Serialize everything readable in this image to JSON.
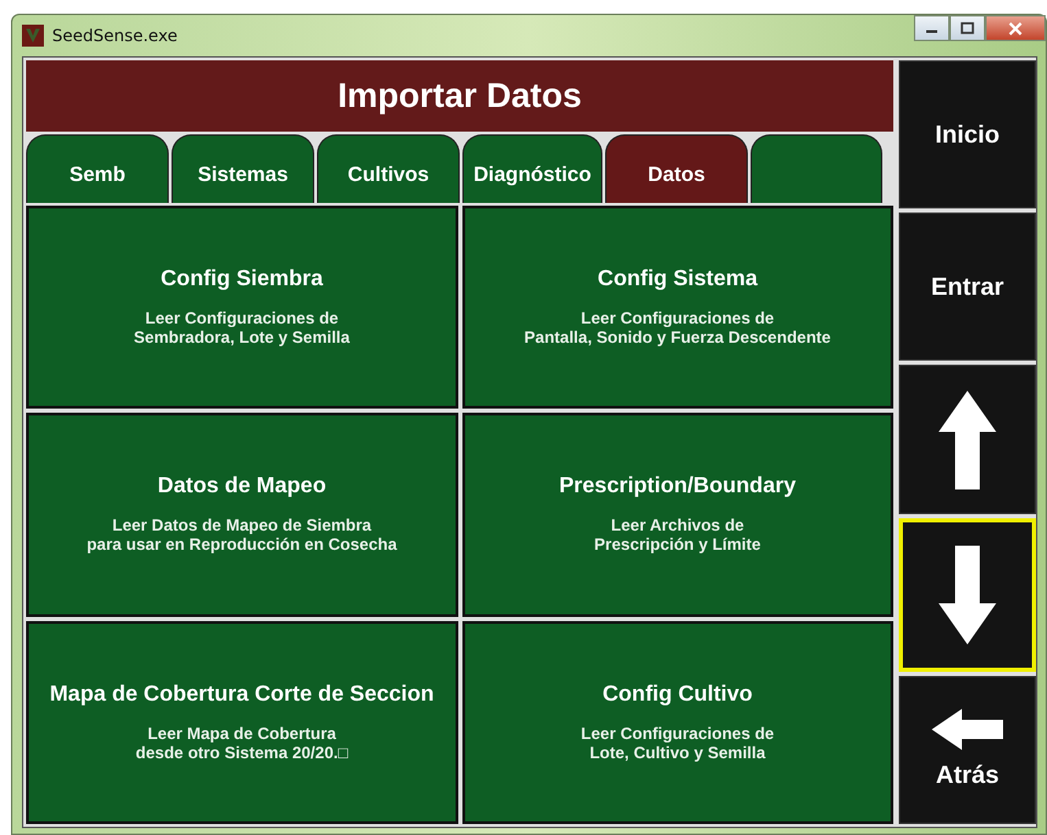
{
  "window": {
    "title": "SeedSense.exe"
  },
  "header": {
    "title": "Importar Datos"
  },
  "tabs": [
    {
      "label": "Semb",
      "selected": false
    },
    {
      "label": "Sistemas",
      "selected": false
    },
    {
      "label": "Cultivos",
      "selected": false
    },
    {
      "label": "Diagnóstico",
      "selected": false
    },
    {
      "label": "Datos",
      "selected": true
    },
    {
      "selected": false
    }
  ],
  "tiles": [
    {
      "title": "Config Siembra",
      "description": "Leer Configuraciones de\nSembradora, Lote y Semilla"
    },
    {
      "title": "Config Sistema",
      "description": "Leer Configuraciones de\nPantalla, Sonido y Fuerza Descendente"
    },
    {
      "title": "Datos de Mapeo",
      "description": "Leer Datos de Mapeo de Siembra\npara usar en Reproducción en Cosecha"
    },
    {
      "title": "Prescription/Boundary",
      "description": "Leer Archivos de\nPrescripción y Límite"
    },
    {
      "title": "Mapa de Cobertura Corte de Seccion",
      "description": "Leer Mapa de Cobertura\ndesde otro Sistema 20/20.□"
    },
    {
      "title": "Config Cultivo",
      "description": "Leer Configuraciones de\nLote, Cultivo y Semilla"
    }
  ],
  "nav_buttons": [
    {
      "kind": "text",
      "label": "Inicio",
      "focused": false
    },
    {
      "kind": "text",
      "label": "Entrar",
      "focused": false
    },
    {
      "kind": "up",
      "focused": false
    },
    {
      "kind": "down",
      "focused": true
    },
    {
      "kind": "back",
      "label": "Atrás",
      "focused": false
    }
  ]
}
